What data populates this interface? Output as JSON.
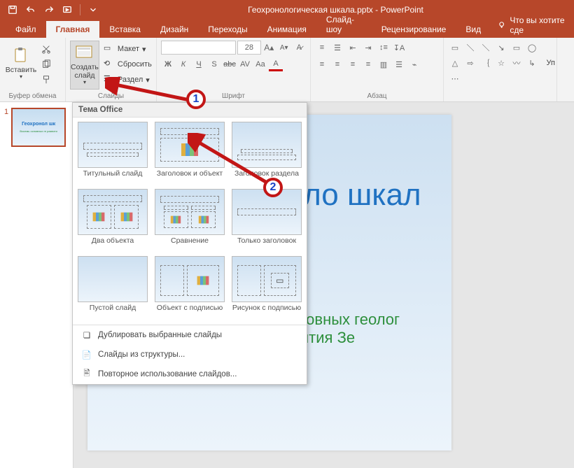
{
  "title_bar": {
    "app_title": "Геохронологическая шкала.pptx - PowerPoint"
  },
  "tabs": {
    "file": "Файл",
    "home": "Главная",
    "insert": "Вставка",
    "design": "Дизайн",
    "transitions": "Переходы",
    "animations": "Анимация",
    "slideshow": "Слайд-шоу",
    "review": "Рецензирование",
    "view": "Вид",
    "tell_me": "Что вы хотите сде"
  },
  "ribbon": {
    "paste": "Вставить",
    "clipboard_group": "Буфер обмена",
    "new_slide": "Создать слайд",
    "layout": "Макет",
    "reset": "Сбросить",
    "section": "Раздел",
    "slides_group": "Слайды",
    "font_size": "28",
    "font_group": "Шрифт",
    "para_group": "Абзац",
    "arrange_label": "Уп"
  },
  "layout_popup": {
    "header": "Тема Office",
    "items": [
      "Титульный слайд",
      "Заголовок и объект",
      "Заголовок раздела",
      "Два объекта",
      "Сравнение",
      "Только заголовок",
      "Пустой слайд",
      "Объект с подписью",
      "Рисунок с подписью"
    ],
    "menu": {
      "duplicate": "Дублировать выбранные слайды",
      "outline": "Слайды из структуры...",
      "reuse": "Повторное использование слайдов..."
    }
  },
  "thumbnail": {
    "num": "1",
    "title": "Геохронол шк",
    "sub": "Восемь основных ге развити"
  },
  "slide": {
    "title": "Геохроноло шкал",
    "sub_line1": "Восемь основных геолог",
    "sub_line2": "развития Зе"
  },
  "callouts": {
    "one": "1",
    "two": "2"
  }
}
